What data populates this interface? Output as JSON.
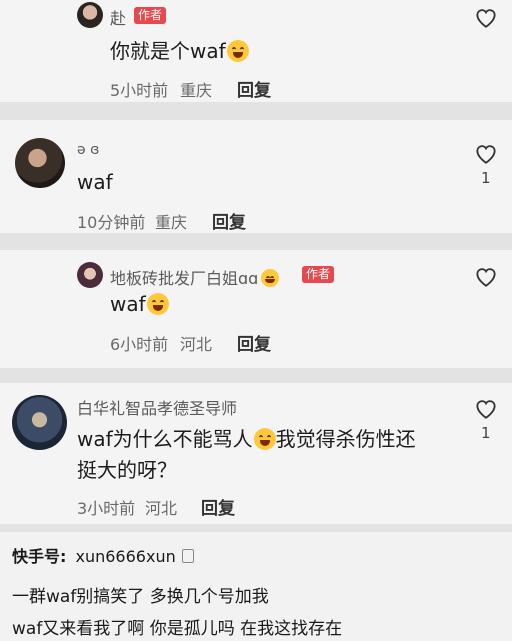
{
  "comments": [
    {
      "name": "赴",
      "badge": "作者",
      "text": "你就是个waf",
      "time": "5小时前",
      "location": "重庆",
      "reply": "回复",
      "likes": ""
    },
    {
      "name": "ə ɞ",
      "badge": "",
      "text": "waf",
      "time": "10分钟前",
      "location": "重庆",
      "reply": "回复",
      "likes": "1"
    },
    {
      "name": "地板砖批发厂白姐ɑɑ",
      "badge": "作者",
      "text": "waf",
      "time": "6小时前",
      "location": "河北",
      "reply": "回复",
      "likes": ""
    },
    {
      "name": "白华礼智品孝德圣导师",
      "badge": "",
      "text_line1a": "waf为什么不能骂人",
      "text_line1b": "我觉得杀伤性还",
      "text_line2": "挺大的呀？",
      "time": "3小时前",
      "location": "河北",
      "reply": "回复",
      "likes": "1"
    }
  ],
  "footer": {
    "kuai_label": "快手号:",
    "kuai_id": "xun6666xun",
    "line1": "一群waf别搞笑了 多换几个号加我",
    "line2": "waf又来看我了啊 你是孤儿吗 在我这找存在"
  },
  "icons": {
    "like": "heart-outline-icon",
    "copy": "copy-icon",
    "emoji": "grin-emoji-icon"
  }
}
